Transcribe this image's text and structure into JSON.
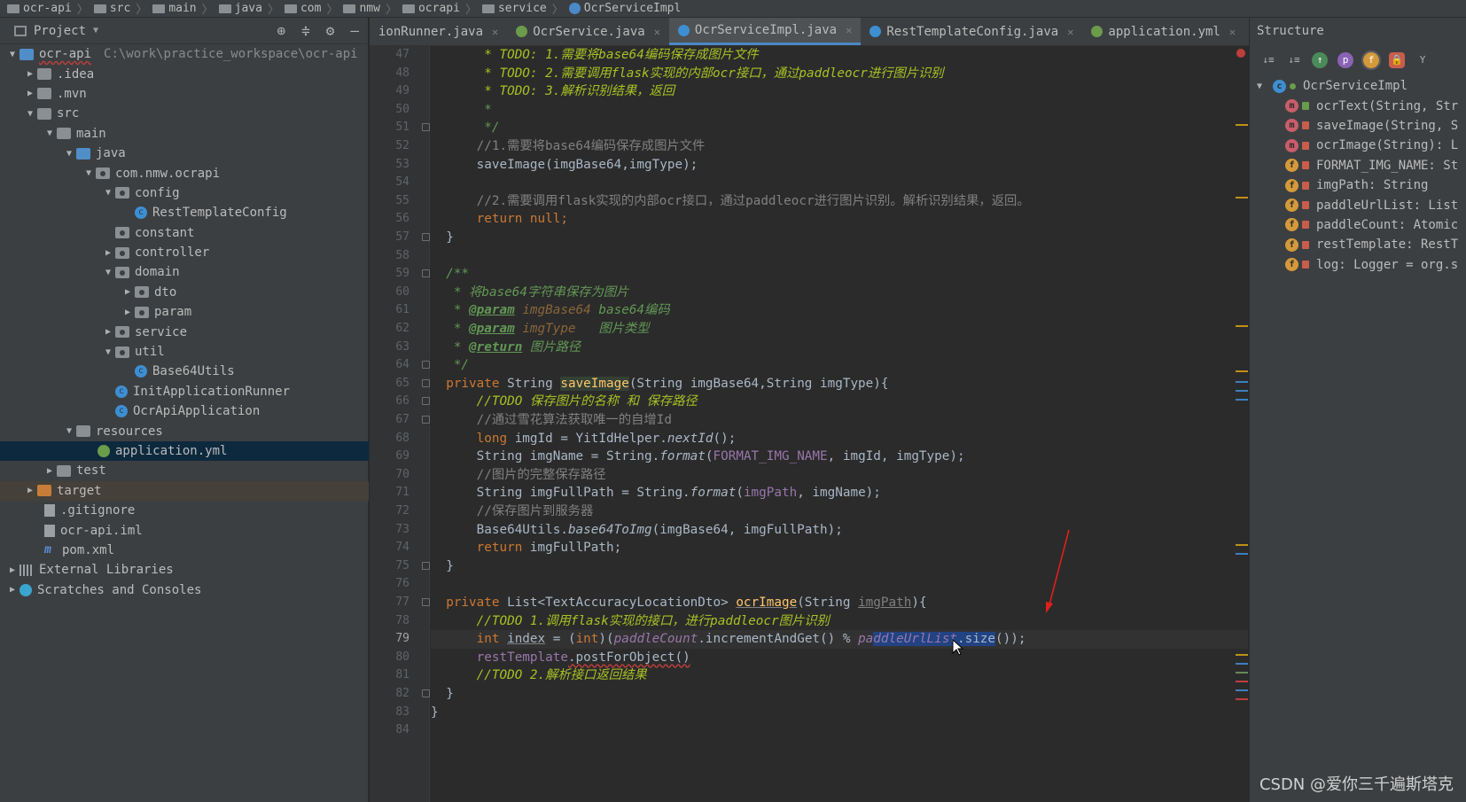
{
  "breadcrumb": [
    "ocr-api",
    "src",
    "main",
    "java",
    "com",
    "nmw",
    "ocrapi",
    "service",
    "OcrServiceImpl"
  ],
  "project": {
    "title": "Project",
    "tree": [
      {
        "label": "ocr-api",
        "path": "C:\\work\\practice_workspace\\ocr-api",
        "icon": "module-folder-icon"
      },
      {
        "label": ".idea"
      },
      {
        "label": ".mvn"
      },
      {
        "label": "src"
      },
      {
        "label": "main"
      },
      {
        "label": "java"
      },
      {
        "label": "com.nmw.ocrapi"
      },
      {
        "label": "config"
      },
      {
        "label": "RestTemplateConfig"
      },
      {
        "label": "constant"
      },
      {
        "label": "controller"
      },
      {
        "label": "domain"
      },
      {
        "label": "dto"
      },
      {
        "label": "param"
      },
      {
        "label": "service"
      },
      {
        "label": "util"
      },
      {
        "label": "Base64Utils"
      },
      {
        "label": "InitApplicationRunner"
      },
      {
        "label": "OcrApiApplication"
      },
      {
        "label": "resources"
      },
      {
        "label": "application.yml"
      },
      {
        "label": "test"
      },
      {
        "label": "target"
      },
      {
        "label": ".gitignore"
      },
      {
        "label": "ocr-api.iml"
      },
      {
        "label": "pom.xml"
      },
      {
        "label": "External Libraries"
      },
      {
        "label": "Scratches and Consoles"
      }
    ]
  },
  "tabs": [
    {
      "label": "ionRunner.java",
      "color": "#3d8fd1"
    },
    {
      "label": "OcrService.java",
      "color": "#6a9c4b"
    },
    {
      "label": "OcrServiceImpl.java",
      "color": "#3d8fd1",
      "active": true
    },
    {
      "label": "RestTemplateConfig.java",
      "color": "#3d8fd1"
    },
    {
      "label": "application.yml",
      "color": "#6a9c4b"
    }
  ],
  "editor": {
    "current_line": 79,
    "line_numbers": [
      "47",
      "48",
      "49",
      "50",
      "51",
      "52",
      "53",
      "54",
      "55",
      "56",
      "57",
      "58",
      "59",
      "60",
      "61",
      "62",
      "63",
      "64",
      "65",
      "66",
      "67",
      "68",
      "69",
      "70",
      "71",
      "72",
      "73",
      "74",
      "75",
      "76",
      "77",
      "78",
      "79",
      "80",
      "81",
      "82",
      "83",
      "84"
    ],
    "code": {
      "l47": "TODO: 1.需要将base64编码保存成图片文件",
      "l48": "TODO: 2.需要调用flask实现的内部ocr接口，通过paddleocr进行图片识别",
      "l49": "TODO: 3.解析识别结果，返回",
      "l52": "//1.需要将base64编码保存成图片文件",
      "l53a": "saveImage(imgBase64",
      "l53b": ",imgType);",
      "l55": "//2.需要调用flask实现的内部ocr接口，通过paddleocr进行图片识别。解析识别结果，返回。",
      "l56a": "return",
      "l56b": "null;",
      "l59": "/**",
      "l60": " * 将base64字符串保存为图片",
      "l61a": "@param",
      "l61b": "imgBase64",
      "l61c": "base64编码",
      "l62a": "@param",
      "l62b": "imgType",
      "l62c": "  图片类型",
      "l63a": "@return",
      "l63b": "图片路径",
      "l64": " */",
      "l65a": "private",
      "l65b": "String",
      "l65c": "saveImage",
      "l65d": "(String imgBase64",
      "l65e": ",String imgType){",
      "l66": "//TODO 保存图片的名称 和 保存路径",
      "l67": "//通过雪花算法获取唯一的自增Id",
      "l68a": "long",
      "l68b": " imgId = YitIdHelper.",
      "l68c": "nextId",
      "l68d": "();",
      "l69a": "String imgName = String.",
      "l69b": "format",
      "l69c": "(",
      "l69d": "FORMAT_IMG_NAME",
      "l69e": ", imgId, imgType);",
      "l70": "//图片的完整保存路径",
      "l71a": "String imgFullPath = String.",
      "l71b": "format",
      "l71c": "(",
      "l71d": "imgPath",
      "l71e": ", imgName);",
      "l72": "//保存图片到服务器",
      "l73a": "Base64Utils.",
      "l73b": "base64ToImg",
      "l73c": "(imgBase64, imgFullPath);",
      "l74a": "return",
      "l74b": " imgFullPath;",
      "l77a": "private",
      "l77b": " List<TextAccuracyLocationDto> ",
      "l77c": "ocrImage",
      "l77d": "(String ",
      "l77e": "imgPath",
      "l77f": "){",
      "l78": "//TODO 1.调用flask实现的接口，进行paddleocr图片识别",
      "l79a": "int",
      "l79b": "index",
      "l79c": " = (",
      "l79d": "int",
      "l79e": ")(",
      "l79f": "paddleCount",
      "l79g": ".incrementAndGet() % ",
      "l79h": "pa",
      "l79i": "ddleUrlList",
      "l79j": ".size",
      "l79k": "());",
      "l80a": "restTemplate",
      "l80b": ".postForObject()",
      "l81": "//TODO 2.解析接口返回结果",
      "close": "}"
    }
  },
  "structure": {
    "title": "Structure",
    "root": "OcrServiceImpl",
    "items": [
      {
        "type": "m",
        "label": "ocrText(String, Str"
      },
      {
        "type": "m",
        "label": "saveImage(String, S"
      },
      {
        "type": "m",
        "label": "ocrImage(String): L"
      },
      {
        "type": "f",
        "label": "FORMAT_IMG_NAME: St"
      },
      {
        "type": "f",
        "label": "imgPath: String"
      },
      {
        "type": "f",
        "label": "paddleUrlList: List"
      },
      {
        "type": "f",
        "label": "paddleCount: Atomic"
      },
      {
        "type": "f",
        "label": "restTemplate: RestT"
      },
      {
        "type": "f",
        "label": "log: Logger = org.s"
      }
    ]
  },
  "watermark": "CSDN @爱你三千遍斯塔克"
}
